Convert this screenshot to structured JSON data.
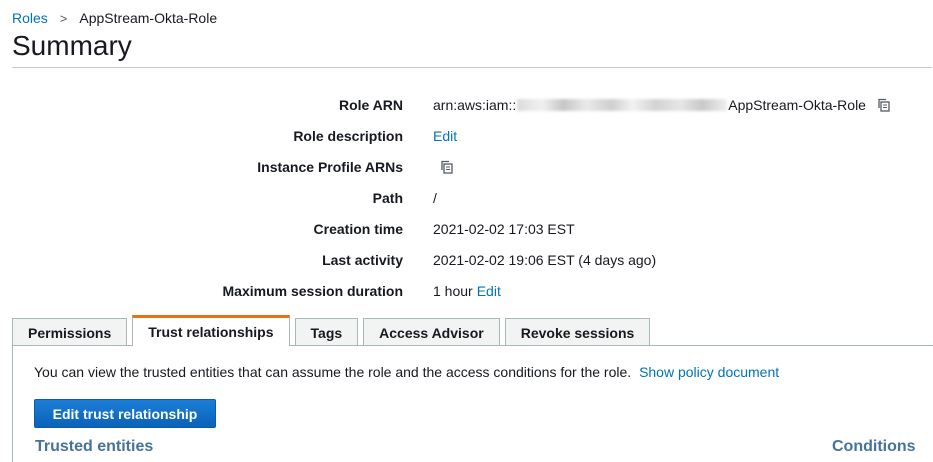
{
  "breadcrumb": {
    "roles_label": "Roles",
    "separator": ">",
    "current": "AppStream-Okta-Role"
  },
  "page_title": "Summary",
  "details": {
    "role_arn": {
      "label": "Role ARN",
      "prefix": "arn:aws:iam::",
      "suffix": "AppStream-Okta-Role"
    },
    "role_description": {
      "label": "Role description",
      "edit_label": "Edit"
    },
    "instance_profile_arns": {
      "label": "Instance Profile ARNs"
    },
    "path": {
      "label": "Path",
      "value": "/"
    },
    "creation_time": {
      "label": "Creation time",
      "value": "2021-02-02 17:03 EST"
    },
    "last_activity": {
      "label": "Last activity",
      "value": "2021-02-02 19:06 EST (4 days ago)"
    },
    "max_session": {
      "label": "Maximum session duration",
      "value": "1 hour",
      "edit_label": "Edit"
    }
  },
  "tabs": [
    {
      "label": "Permissions"
    },
    {
      "label": "Trust relationships"
    },
    {
      "label": "Tags"
    },
    {
      "label": "Access Advisor"
    },
    {
      "label": "Revoke sessions"
    }
  ],
  "active_tab": "Trust relationships",
  "trust_panel": {
    "description": "You can view the trusted entities that can assume the role and the access conditions for the role.",
    "show_policy_link": "Show policy document",
    "edit_button": "Edit trust relationship",
    "trusted_entities_heading": "Trusted entities",
    "conditions_heading": "Conditions"
  },
  "colors": {
    "link": "#0073bb",
    "active_tab_accent": "#ec7211",
    "primary_button": "#0a63b7",
    "section_heading": "#44749a"
  },
  "icons": {
    "copy": "copy-icon",
    "breadcrumb_separator": "chevron-right-icon"
  }
}
